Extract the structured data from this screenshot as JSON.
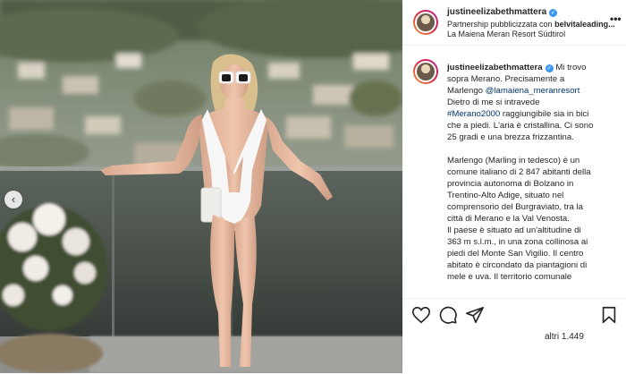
{
  "post": {
    "username": "justineelizabethmattera",
    "partnership_label": "Partnership pubblicizzata con ",
    "partner": "belvitaleading...",
    "location": "La Maiena Meran Resort Südtirol",
    "caption_lines": [
      {
        "pre": "",
        "link": "",
        "post": "Mi trovo"
      },
      {
        "pre": "sopra Merano. Precisamente a",
        "link": "",
        "post": ""
      },
      {
        "pre": "Marlengo ",
        "link": "@lamaiena_meranresort",
        "post": ""
      },
      {
        "pre": "Dietro di me si intravede",
        "link": "",
        "post": ""
      },
      {
        "pre": "",
        "link": "#Merano2000",
        "post": " raggiungibile sia in bici"
      },
      {
        "pre": "che a piedi. L'aria è cristallina. Ci sono",
        "link": "",
        "post": ""
      },
      {
        "pre": "25 gradi e una brezza frizzantina.",
        "link": "",
        "post": ""
      },
      {
        "gap": true
      },
      {
        "pre": "Marlengo (Marling in tedesco) è un",
        "link": "",
        "post": ""
      },
      {
        "pre": "comune italiano di 2 847 abitanti della",
        "link": "",
        "post": ""
      },
      {
        "pre": "provincia autonoma di Bolzano in",
        "link": "",
        "post": ""
      },
      {
        "pre": "Trentino-Alto Adige, situato nel",
        "link": "",
        "post": ""
      },
      {
        "pre": "comprensorio del Burgraviato, tra la",
        "link": "",
        "post": ""
      },
      {
        "pre": "città di Merano e la Val Venosta.",
        "link": "",
        "post": ""
      },
      {
        "pre": "Il paese è situato ad un'altitudine di",
        "link": "",
        "post": ""
      },
      {
        "pre": "363 m s.l.m., in una zona collinosa ai",
        "link": "",
        "post": ""
      },
      {
        "pre": "piedi del Monte San Vigilio. Il centro",
        "link": "",
        "post": ""
      },
      {
        "pre": "abitato è circondato da piantagioni di",
        "link": "",
        "post": ""
      },
      {
        "pre": "mele e uva. Il territorio comunale",
        "link": "",
        "post": ""
      }
    ],
    "likes_text": "altri 1.449",
    "photo_prev_arrow": "‹",
    "more_icon": "•••",
    "verified_glyph": "✓"
  },
  "icons": [
    "more-icon",
    "verified-icon",
    "heart-icon",
    "comment-icon",
    "share-icon",
    "bookmark-icon",
    "chevron-left-icon"
  ]
}
